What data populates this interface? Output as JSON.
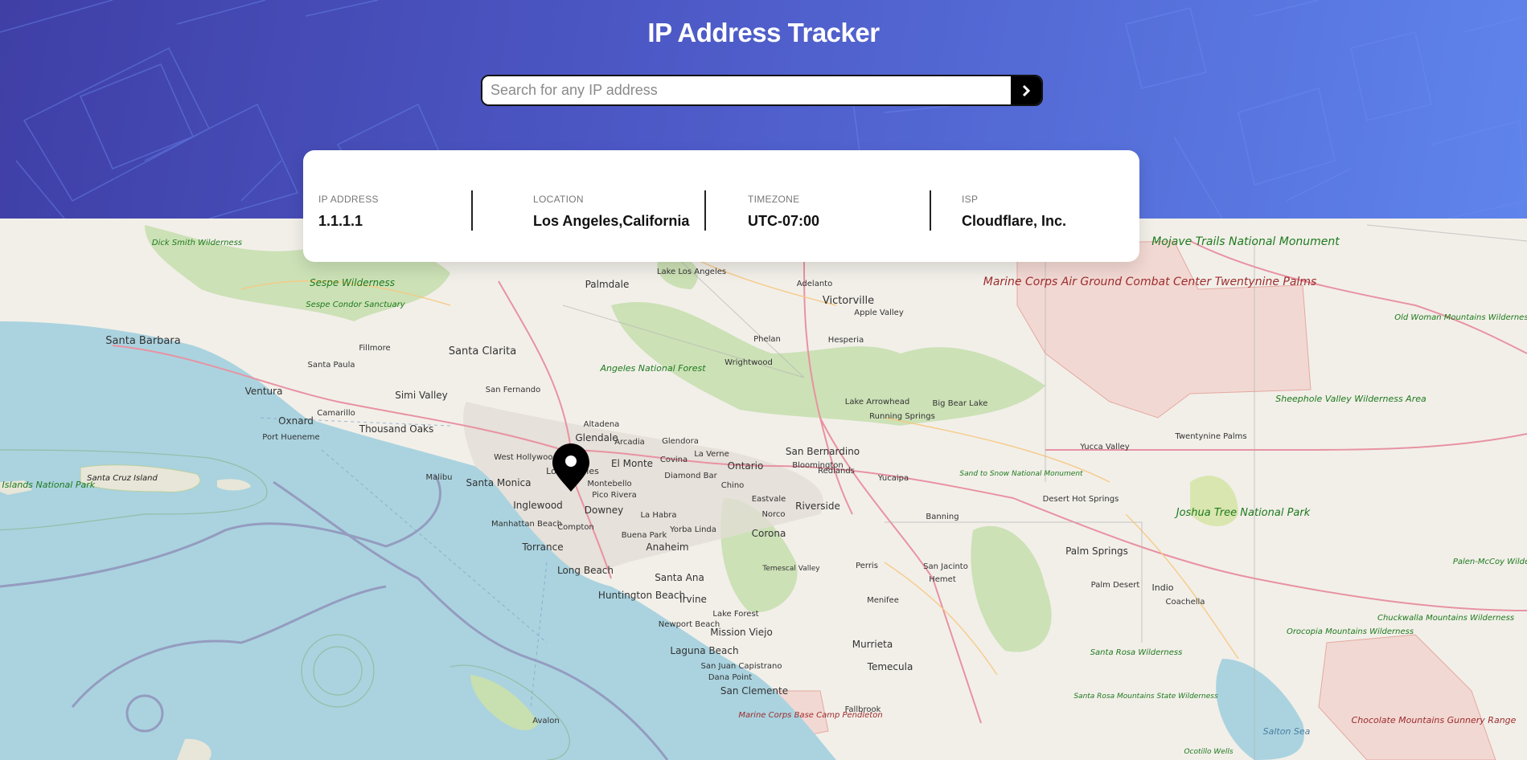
{
  "app": {
    "title": "IP Address Tracker"
  },
  "search": {
    "placeholder": "Search for any IP address",
    "button_icon": "chevron-right-icon"
  },
  "info": {
    "ip_label": "IP ADDRESS",
    "ip_value": "1.1.1.1",
    "location_label": "LOCATION",
    "location_value": "Los Angeles,California",
    "timezone_label": "TIMEZONE",
    "timezone_value": "UTC-07:00",
    "isp_label": "ISP",
    "isp_value": "Cloudflare, Inc."
  },
  "map": {
    "marker_icon": "location-pin-icon",
    "labels": {
      "mojave": "Mojave Trails National Monument",
      "marine_corps": "Marine Corps Air Ground Combat Center Twentynine Palms",
      "dick_smith": "Dick Smith Wilderness",
      "sespe": "Sespe Wilderness",
      "sespe_condor": "Sespe Condor Sanctuary",
      "palmdale": "Palmdale",
      "lake_la": "Lake Los Angeles",
      "adelanto": "Adelanto",
      "victorville": "Victorville",
      "apple_valley": "Apple Valley",
      "old_woman": "Old Woman Mountains Wilderness",
      "santa_barbara": "Santa Barbara",
      "fillmore": "Fillmore",
      "santa_clarita": "Santa Clarita",
      "phelan": "Phelan",
      "hesperia": "Hesperia",
      "santa_paula": "Santa Paula",
      "angeles": "Angeles National Forest",
      "wrightwood": "Wrightwood",
      "sheephole": "Sheephole Valley Wilderness Area",
      "ventura": "Ventura",
      "simi_valley": "Simi Valley",
      "san_fernando": "San Fernando",
      "lake_arrowhead": "Lake Arrowhead",
      "big_bear": "Big Bear Lake",
      "oxnard": "Oxnard",
      "camarillo": "Camarillo",
      "thousand_oaks": "Thousand Oaks",
      "altadena": "Altadena",
      "running_springs": "Running Springs",
      "port_hueneme": "Port Hueneme",
      "glendale": "Glendale",
      "arcadia": "Arcadia",
      "glendora": "Glendora",
      "twentynine_palms": "Twentynine Palms",
      "west_hollywood": "West Hollywood",
      "el_monte": "El Monte",
      "covina": "Covina",
      "la_verne": "La Verne",
      "san_bernardino": "San Bernardino",
      "yucca_valley": "Yucca Valley",
      "los_angeles": "Los Angeles",
      "ontario": "Ontario",
      "bloomington": "Bloomington",
      "channel_islands": "Channel Islands National Park",
      "santa_cruz": "Santa Cruz Island",
      "malibu": "Malibu",
      "santa_monica": "Santa Monica",
      "montebello": "Montebello",
      "diamond_bar": "Diamond Bar",
      "chino": "Chino",
      "redlands": "Redlands",
      "yucaipa": "Yucaipa",
      "sand_to_snow": "Sand to Snow National Monument",
      "pico_rivera": "Pico Rivera",
      "eastvale": "Eastvale",
      "desert_hot": "Desert Hot Springs",
      "inglewood": "Inglewood",
      "downey": "Downey",
      "riverside": "Riverside",
      "norco": "Norco",
      "la_habra": "La Habra",
      "banning": "Banning",
      "joshua_tree": "Joshua Tree National Park",
      "manhattan": "Manhattan Beach",
      "compton": "Compton",
      "yorba_linda": "Yorba Linda",
      "buena_park": "Buena Park",
      "corona": "Corona",
      "torrance": "Torrance",
      "anaheim": "Anaheim",
      "palm_springs": "Palm Springs",
      "palen": "Palen-McCoy Wilderness",
      "temescal": "Temescal Valley",
      "perris": "Perris",
      "san_jacinto": "San Jacinto",
      "hemet": "Hemet",
      "long_beach": "Long Beach",
      "santa_ana": "Santa Ana",
      "palm_desert": "Palm Desert",
      "indio": "Indio",
      "huntington": "Huntington Beach",
      "irvine": "Irvine",
      "menifee": "Menifee",
      "coachella": "Coachella",
      "chuckwalla": "Chuckwalla Mountains Wilderness",
      "lake_forest": "Lake Forest",
      "newport": "Newport Beach",
      "orocopia": "Orocopia Mountains Wilderness",
      "mission_viejo": "Mission Viejo",
      "murrieta": "Murrieta",
      "santa_rosa": "Santa Rosa Wilderness",
      "laguna": "Laguna Beach",
      "san_juan": "San Juan Capistrano",
      "temecula": "Temecula",
      "dana_point": "Dana Point",
      "santa_rosa_sj": "Santa Rosa Mountains State Wilderness",
      "san_clemente": "San Clemente",
      "marine_base": "Marine Corps Base Camp Pendleton",
      "fallbrook": "Fallbrook",
      "avalon": "Avalon",
      "salton_sea": "Salton Sea",
      "chocolate": "Chocolate Mountains Gunnery Range",
      "ocotillo": "Ocotillo Wells"
    }
  }
}
